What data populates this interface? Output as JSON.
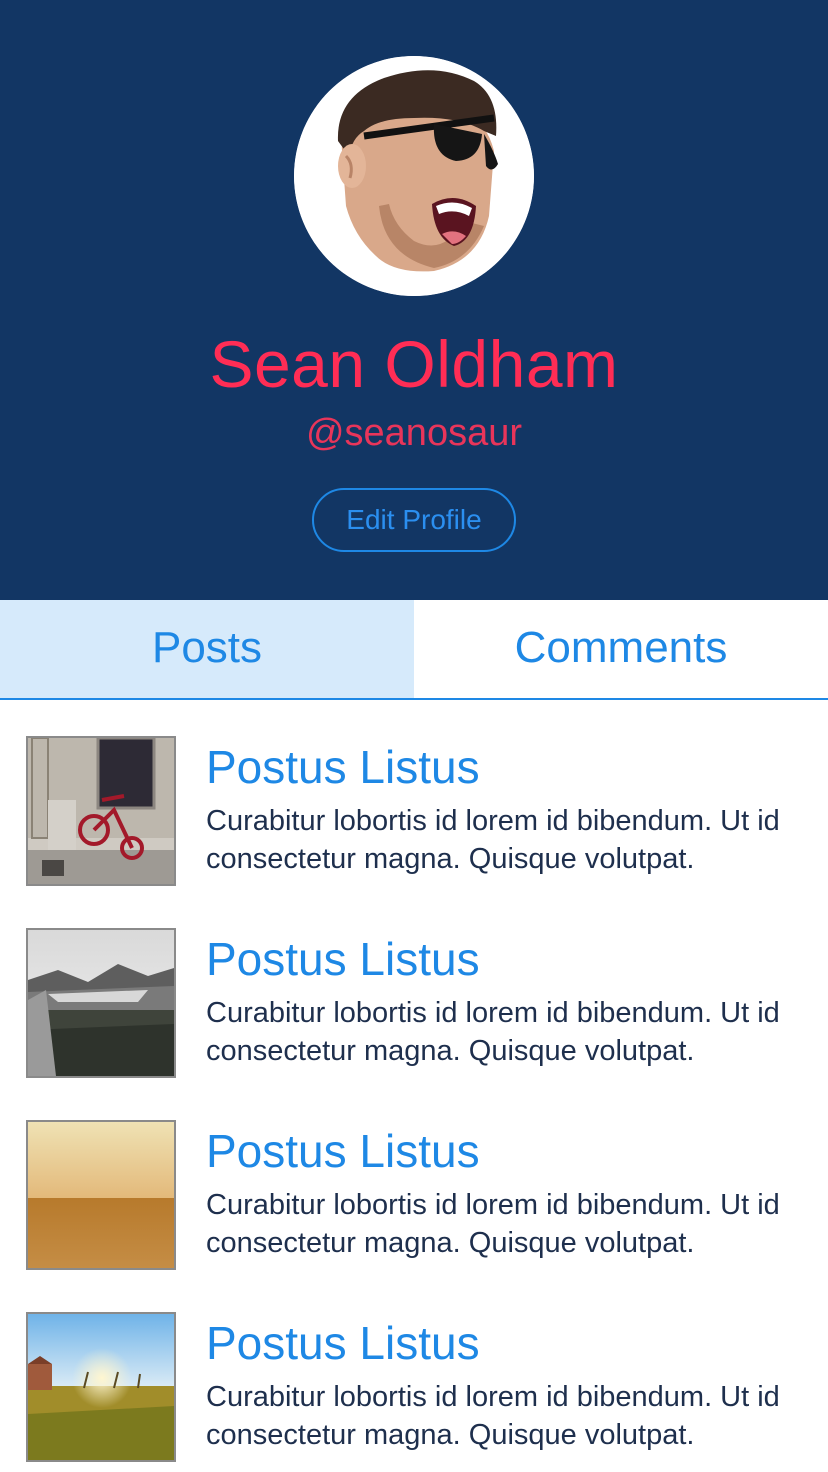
{
  "profile": {
    "name": "Sean Oldham",
    "handle": "@seanosaur",
    "edit_button": "Edit Profile",
    "colors": {
      "header_bg": "#123664",
      "name": "#ff2d55",
      "accent": "#1e88e5"
    }
  },
  "tabs": [
    {
      "label": "Posts",
      "active": true
    },
    {
      "label": "Comments",
      "active": false
    }
  ],
  "posts": [
    {
      "title": "Postus Listus",
      "body": "Curabitur lobortis id lorem id bibendum. Ut id consectetur magna. Quisque volutpat.",
      "thumb": "tricycle-photo"
    },
    {
      "title": "Postus Listus",
      "body": "Curabitur lobortis id lorem id bibendum. Ut id consectetur magna. Quisque volutpat.",
      "thumb": "mountain-landscape-photo"
    },
    {
      "title": "Postus Listus",
      "body": "Curabitur lobortis id lorem id bibendum. Ut id consectetur magna. Quisque volutpat.",
      "thumb": "desert-sunset-photo"
    },
    {
      "title": "Postus Listus",
      "body": "Curabitur lobortis id lorem id bibendum. Ut id consectetur magna. Quisque volutpat.",
      "thumb": "sunny-field-photo"
    }
  ]
}
